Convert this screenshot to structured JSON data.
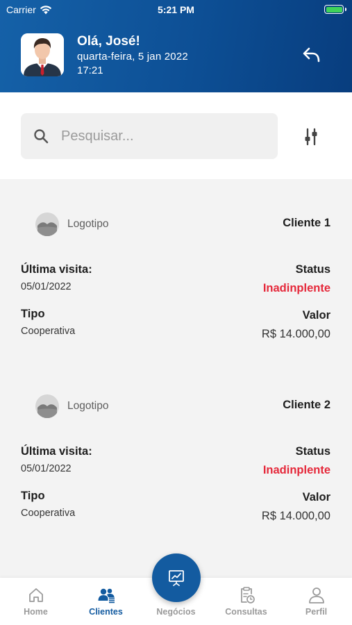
{
  "status_bar": {
    "carrier": "Carrier",
    "time": "5:21 PM"
  },
  "header": {
    "greeting": "Olá, José!",
    "date": "quarta-feira, 5 jan 2022",
    "time": "17:21",
    "back_icon": "undo-arrow-icon"
  },
  "search": {
    "placeholder": "Pesquisar...",
    "value": "",
    "filter_icon": "sliders-icon"
  },
  "clients": [
    {
      "logo_label": "Logotipo",
      "name": "Cliente 1",
      "last_visit_label": "Última visita:",
      "last_visit": "05/01/2022",
      "status_label": "Status",
      "status": "Inadinplente",
      "type_label": "Tipo",
      "type": "Cooperativa",
      "value_label": "Valor",
      "value": "R$ 14.000,00"
    },
    {
      "logo_label": "Logotipo",
      "name": "Cliente 2",
      "last_visit_label": "Última visita:",
      "last_visit": "05/01/2022",
      "status_label": "Status",
      "status": "Inadinplente",
      "type_label": "Tipo",
      "type": "Cooperativa",
      "value_label": "Valor",
      "value": "R$ 14.000,00"
    }
  ],
  "tabs": [
    {
      "label": "Home",
      "icon": "home-icon",
      "active": false
    },
    {
      "label": "Clientes",
      "icon": "clients-icon",
      "active": true
    },
    {
      "label": "Negócios",
      "icon": "presentation-icon",
      "active": false
    },
    {
      "label": "Consultas",
      "icon": "clipboard-clock-icon",
      "active": false
    },
    {
      "label": "Perfil",
      "icon": "user-icon",
      "active": false
    }
  ],
  "colors": {
    "primary": "#135ba0",
    "status_alert": "#e5283a",
    "card_bg": "#f3f3f3",
    "battery": "#3fd35a"
  }
}
